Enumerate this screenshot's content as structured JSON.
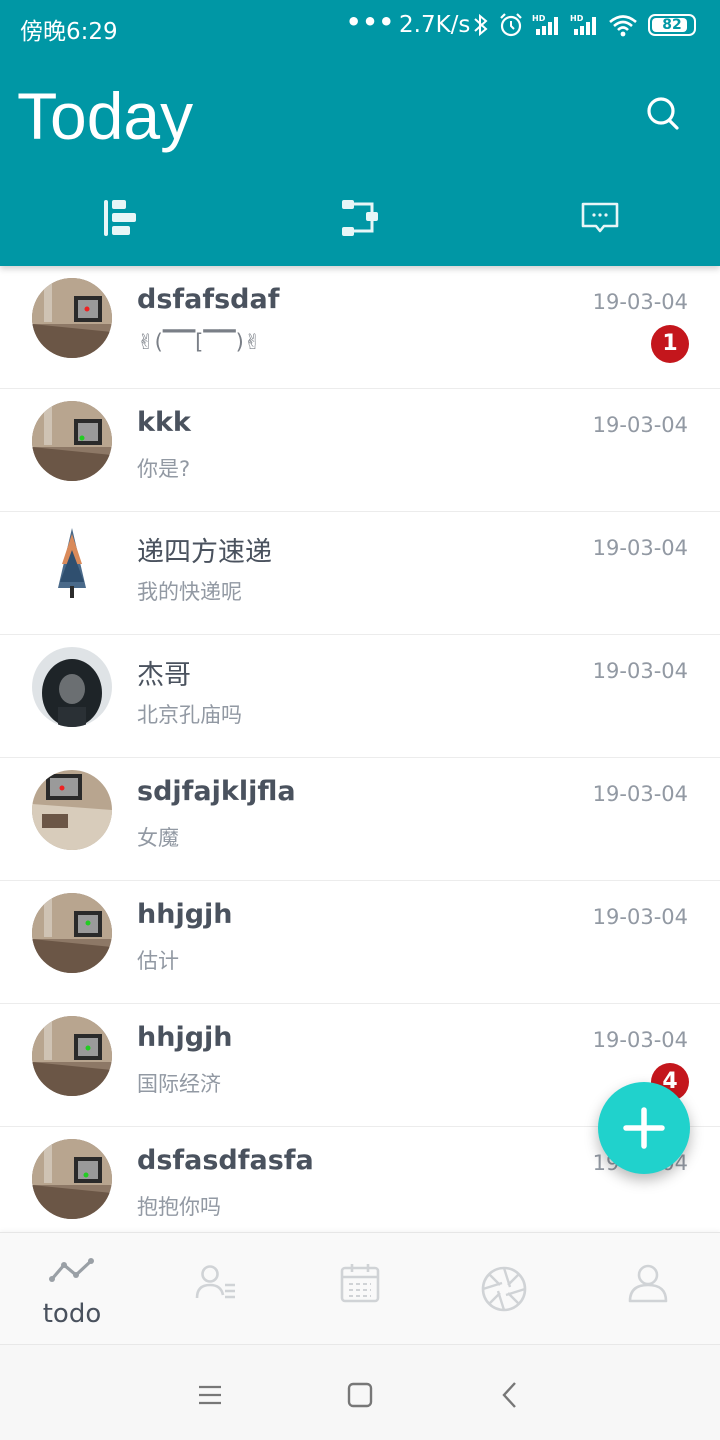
{
  "status_bar": {
    "time": "傍晚6:29",
    "more": "•••",
    "speed": "2.7K/s",
    "battery": "82"
  },
  "header": {
    "title": "Today"
  },
  "conversations": [
    {
      "name": "dsfafsdaf",
      "message": "✌(▔▔[▔▔)✌",
      "time": "19-03-04",
      "badge": "1"
    },
    {
      "name": "kkk",
      "message": "你是?",
      "time": "19-03-04",
      "badge": ""
    },
    {
      "name": "递四方速递",
      "message": "我的快递呢",
      "time": "19-03-04",
      "badge": ""
    },
    {
      "name": "杰哥",
      "message": "北京孔庙吗",
      "time": "19-03-04",
      "badge": ""
    },
    {
      "name": "sdjfajkljfla",
      "message": "女魔",
      "time": "19-03-04",
      "badge": ""
    },
    {
      "name": "hhjgjh",
      "message": "估计",
      "time": "19-03-04",
      "badge": ""
    },
    {
      "name": "hhjgjh",
      "message": "国际经济",
      "time": "19-03-04",
      "badge": "4"
    },
    {
      "name": "dsfasdfasfa",
      "message": "抱抱你吗",
      "time": "19-03-04",
      "badge": ""
    }
  ],
  "bottom_nav": {
    "active_label": "todo",
    "items": [
      "chart-line-icon",
      "contacts-list-icon",
      "calendar-icon",
      "aperture-icon",
      "person-icon"
    ]
  },
  "colors": {
    "primary": "#0097a5",
    "fab": "#20d2cc",
    "badge": "#c4161c"
  }
}
